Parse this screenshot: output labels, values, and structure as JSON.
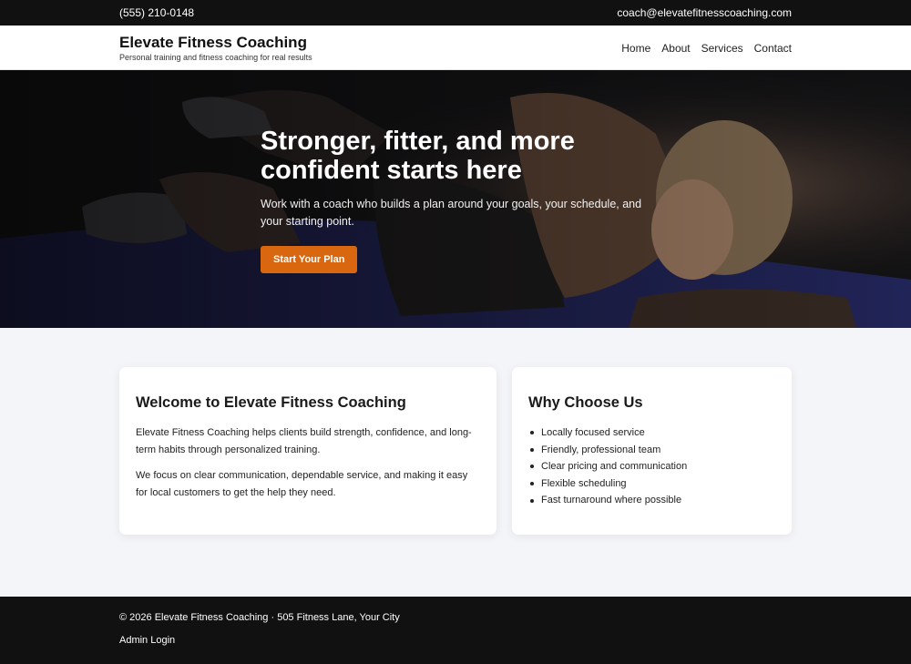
{
  "topbar": {
    "phone": "(555) 210-0148",
    "email": "coach@elevatefitnesscoaching.com"
  },
  "header": {
    "brand_title": "Elevate Fitness Coaching",
    "brand_tagline": "Personal training and fitness coaching for real results",
    "nav": [
      "Home",
      "About",
      "Services",
      "Contact"
    ]
  },
  "hero": {
    "title": "Stronger, fitter, and more confident starts here",
    "subtitle": "Work with a coach who builds a plan around your goals, your schedule, and your starting point.",
    "cta_label": "Start Your Plan",
    "image": "woman-doing-crunches-photo"
  },
  "welcome": {
    "heading": "Welcome to Elevate Fitness Coaching",
    "paragraphs": [
      "Elevate Fitness Coaching helps clients build strength, confidence, and long-term habits through personalized training.",
      "We focus on clear communication, dependable service, and making it easy for local customers to get the help they need."
    ]
  },
  "why": {
    "heading": "Why Choose Us",
    "items": [
      "Locally focused service",
      "Friendly, professional team",
      "Clear pricing and communication",
      "Flexible scheduling",
      "Fast turnaround where possible"
    ]
  },
  "footer": {
    "copyright": "© 2026 Elevate Fitness Coaching · 505 Fitness Lane, Your City",
    "admin_label": "Admin Login"
  },
  "colors": {
    "accent": "#d9670f",
    "dark": "#111111",
    "background": "#f4f5f9"
  }
}
